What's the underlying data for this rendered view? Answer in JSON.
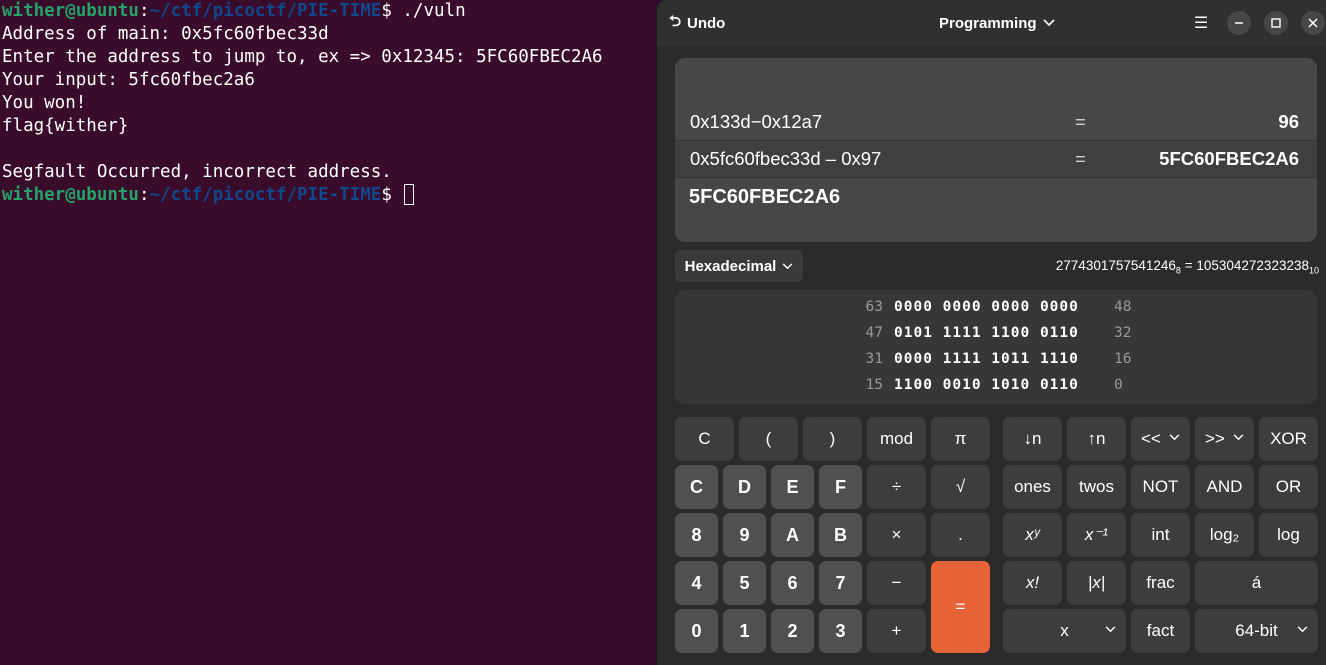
{
  "terminal": {
    "prompt_user": "wither@ubuntu",
    "prompt_sep": ":",
    "prompt_path": "~/ctf/picoctf/PIE-TIME",
    "prompt_end": "$ ",
    "command": "./vuln",
    "lines": [
      "Address of main: 0x5fc60fbec33d",
      "Enter the address to jump to, ex => 0x12345: 5FC60FBEC2A6",
      "Your input: 5fc60fbec2a6",
      "You won!",
      "flag{wither}",
      "",
      "Segfault Occurred, incorrect address."
    ]
  },
  "calculator": {
    "undo_label": "Undo",
    "mode_label": "Programming",
    "history": [
      {
        "expr": "0x133d−0x12a7",
        "eq": "=",
        "result": "96"
      },
      {
        "expr": "0x5fc60fbec33d – 0x97",
        "eq": "=",
        "result": "5FC60FBEC2A6"
      }
    ],
    "current_value": "5FC60FBEC2A6",
    "base_label": "Hexadecimal",
    "conversion": {
      "octal": "2774301757541246",
      "octal_base": "8",
      "eq": "=",
      "decimal": "105304272323238",
      "decimal_base": "10"
    },
    "bits": [
      {
        "left": "63",
        "bits": "0000 0000 0000 0000",
        "right": "48"
      },
      {
        "left": "47",
        "bits": "0101 1111 1100 0110",
        "right": "32"
      },
      {
        "left": "31",
        "bits": "0000 1111 1011 1110",
        "right": "16"
      },
      {
        "left": "15",
        "bits": "1100 0010 1010 0110",
        "right": "0"
      }
    ],
    "keys": {
      "clear": "C",
      "lparen": "(",
      "rparen": ")",
      "mod": "mod",
      "pi": "π",
      "hex_c": "C",
      "hex_d": "D",
      "hex_e": "E",
      "hex_f": "F",
      "divide": "÷",
      "sqrt": "√",
      "n8": "8",
      "n9": "9",
      "hex_a": "A",
      "hex_b": "B",
      "multiply": "×",
      "dot": ".",
      "n4": "4",
      "n5": "5",
      "n6": "6",
      "n7": "7",
      "minus": "−",
      "equals": "=",
      "n0": "0",
      "n1": "1",
      "n2": "2",
      "n3": "3",
      "plus": "+",
      "down_n": "↓n",
      "up_n": "↑n",
      "shl": "<<",
      "shr": ">>",
      "xor": "XOR",
      "ones": "ones",
      "twos": "twos",
      "not": "NOT",
      "and": "AND",
      "or": "OR",
      "pow": "xʸ",
      "inv": "x⁻¹",
      "int": "int",
      "log2": "log₂",
      "log": "log",
      "fact_sym": "x!",
      "abs": "|x|",
      "frac": "frac",
      "acute": "á",
      "x_select": "x",
      "fact": "fact",
      "word_size": "64-bit"
    }
  }
}
